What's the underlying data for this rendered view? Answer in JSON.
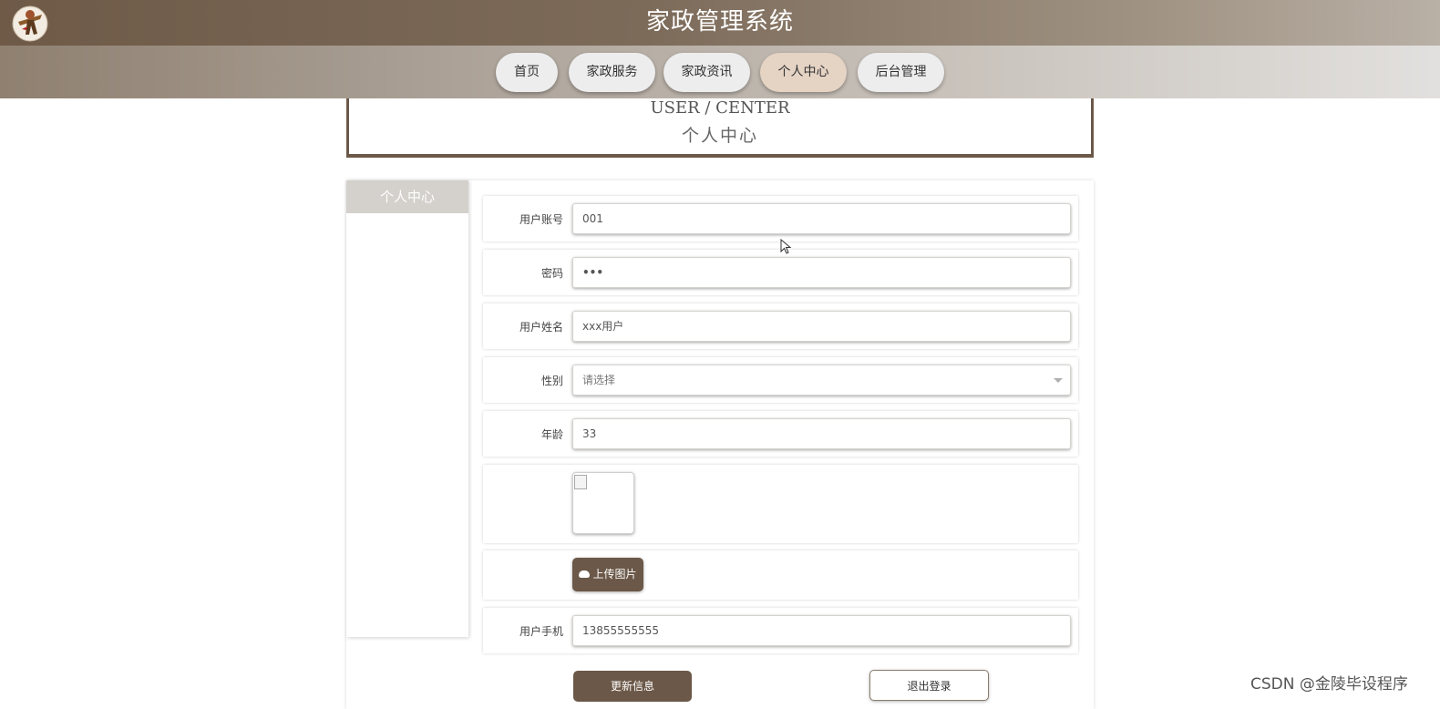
{
  "header": {
    "title": "家政管理系统",
    "logo_icon": "cowboy-logo-icon"
  },
  "nav": {
    "items": [
      {
        "label": "首页"
      },
      {
        "label": "家政服务"
      },
      {
        "label": "家政资讯"
      },
      {
        "label": "个人中心"
      },
      {
        "label": "后台管理"
      }
    ],
    "active": "个人中心"
  },
  "banner": {
    "en": "USER / CENTER",
    "cn": "个人中心"
  },
  "sidebar": {
    "heading": "个人中心"
  },
  "form": {
    "account_label": "用户账号",
    "account_value": "001",
    "password_label": "密码",
    "password_value": "•••",
    "name_label": "用户姓名",
    "name_value": "xxx用户",
    "gender_label": "性别",
    "gender_placeholder": "请选择",
    "age_label": "年龄",
    "age_value": "33",
    "upload_label": "上传图片",
    "phone_label": "用户手机",
    "phone_value": "13855555555"
  },
  "actions": {
    "update_label": "更新信息",
    "logout_label": "退出登录"
  },
  "watermark": "CSDN @金陵毕设程序",
  "colors": {
    "brand": "#6b5848",
    "nav_active": "#e5d3c4",
    "sidebar_head": "#d4d0cc"
  }
}
